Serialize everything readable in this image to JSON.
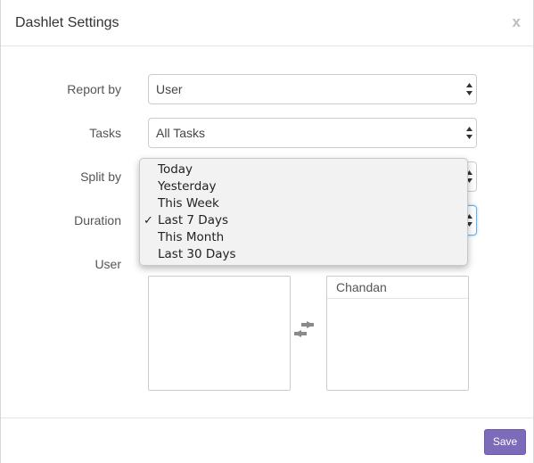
{
  "dialog": {
    "title": "Dashlet Settings",
    "close_label": "x"
  },
  "form": {
    "report_by": {
      "label": "Report by",
      "value": "User"
    },
    "tasks": {
      "label": "Tasks",
      "value": "All Tasks"
    },
    "split_by": {
      "label": "Split by"
    },
    "duration": {
      "label": "Duration",
      "options": [
        "Today",
        "Yesterday",
        "This Week",
        "Last 7 Days",
        "This Month",
        "Last 30 Days"
      ],
      "selected_check": "✓"
    },
    "user": {
      "label": "User",
      "available": [],
      "selected": [
        "Chandan"
      ]
    }
  },
  "footer": {
    "save_label": "Save"
  },
  "colors": {
    "accent": "#7b6bb9",
    "focus_border": "#66afe9"
  }
}
